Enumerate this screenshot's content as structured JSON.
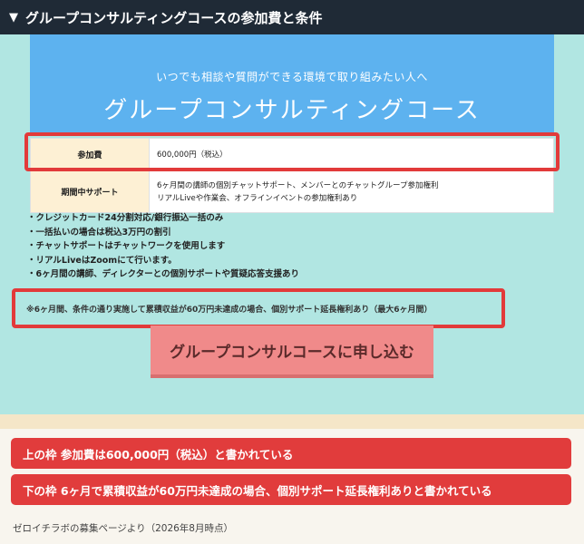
{
  "header": {
    "title": "グループコンサルティングコースの参加費と条件"
  },
  "hero": {
    "subtitle": "いつでも相談や質問ができる環境で取り組みたい人へ",
    "title": "グループコンサルティングコース"
  },
  "table": [
    {
      "label": "参加費",
      "value": [
        "600,000円（税込）"
      ]
    },
    {
      "label": "期間中サポート",
      "value": [
        "6ヶ月間の講師の個別チャットサポート、メンバーとのチャットグループ参加権利",
        "リアルLiveや作業会、オフラインイベントの参加権利あり"
      ]
    }
  ],
  "bullets": [
    "・クレジットカード24分割対応/銀行振込一括のみ",
    "・一括払いの場合は税込3万円の割引",
    "・チャットサポートはチャットワークを使用します",
    "・リアルLiveはZoomにて行います。",
    "・6ヶ月間の講師、ディレクターとの個別サポートや質疑応答支援あり"
  ],
  "note": "※6ヶ月間、条件の通り実施して累積収益が60万円未達成の場合、個別サポート延長権利あり（最大6ヶ月間）",
  "cta_label": "グループコンサルコースに申し込む",
  "banners": [
    "上の枠 参加費は600,000円（税込）と書かれている",
    "下の枠 6ヶ月で累積収益が60万円未達成の場合、個別サポート延長権利ありと書かれている"
  ],
  "footer": "ゼロイチラボの募集ページより（2026年8月時点）",
  "colors": {
    "accent_red": "#e13c3c",
    "hero_blue": "#5db2ef",
    "teal_bg": "#b1e6e2",
    "cta_pink": "#f08a8a"
  }
}
